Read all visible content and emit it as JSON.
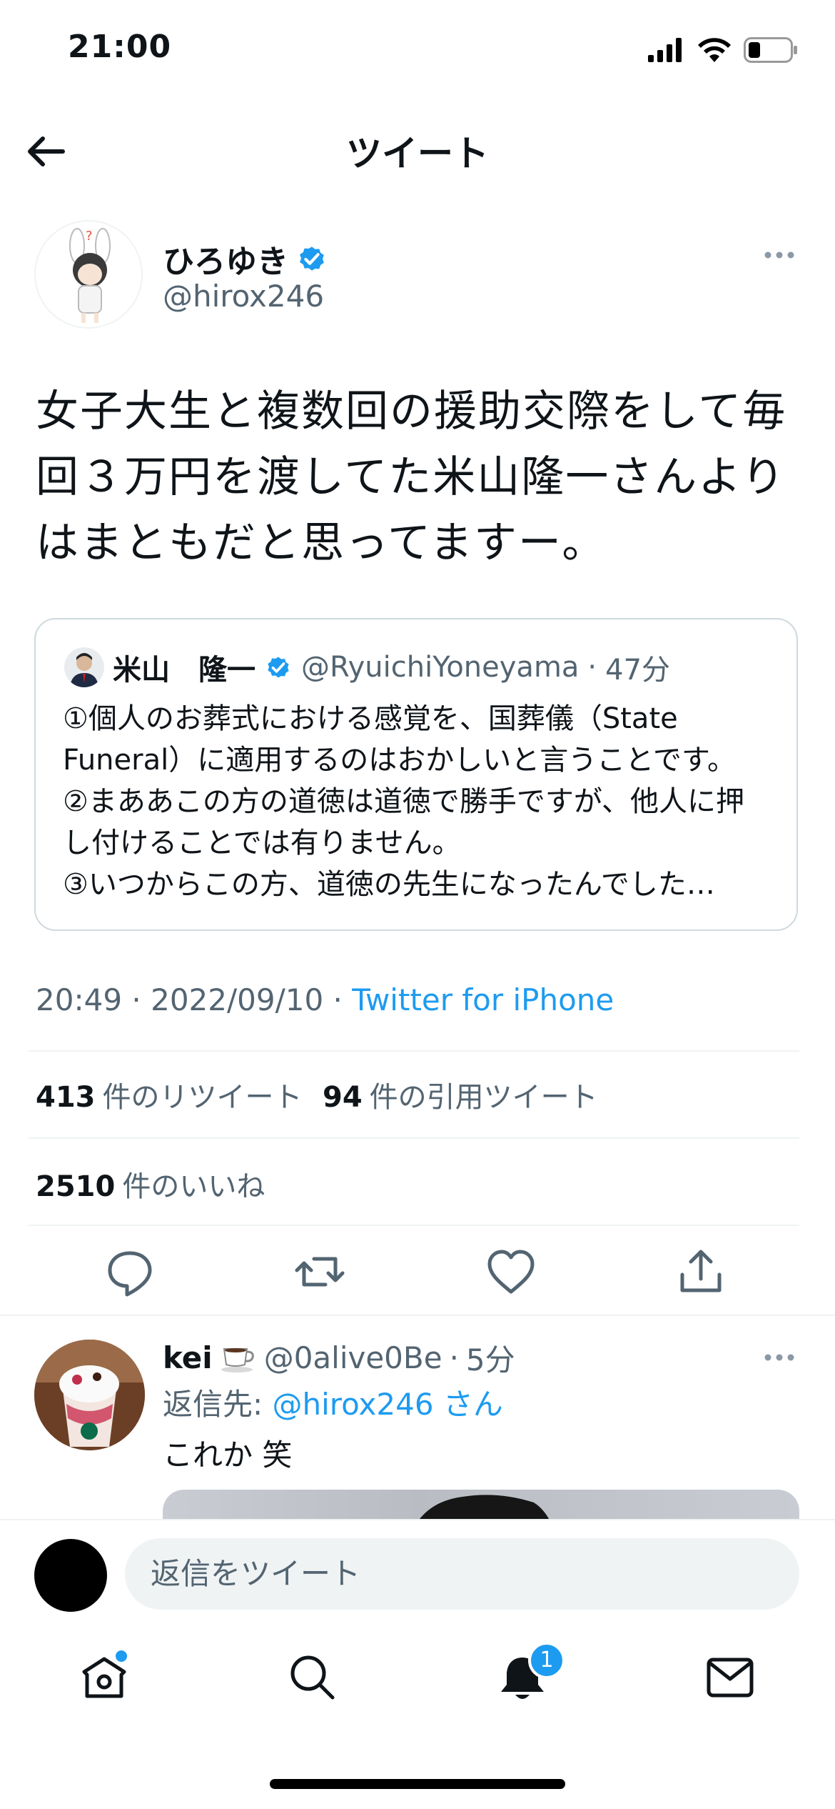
{
  "status": {
    "time": "21:00"
  },
  "header": {
    "title": "ツイート"
  },
  "tweet": {
    "display_name": "ひろゆき",
    "handle": "@hirox246",
    "text_lines": [
      "女子大生と複数回の援助交際をして毎",
      "回３万円を渡してた米山隆一さんより",
      "はまともだと思ってますー。"
    ],
    "quote": {
      "display_name": "米山　隆一",
      "handle": "@RyuichiYoneyama",
      "time": "47分",
      "lines": [
        "①個人のお葬式における感覚を、国葬儀（State",
        "Funeral）に適用するのはおかしいと言うことです。",
        "②まああこの方の道徳は道徳で勝手ですが、他人に押",
        "し付けることでは有りません。",
        "③いつからこの方、道徳の先生になったんでした…"
      ]
    },
    "time": "20:49",
    "date": "2022/09/10",
    "source": "Twitter for iPhone",
    "retweets": "413",
    "retweets_label": "件のリツイート",
    "quotes": "94",
    "quotes_label": "件の引用ツイート",
    "likes": "2510",
    "likes_label": "件のいいね"
  },
  "reply": {
    "display_name": "kei",
    "handle": "@0alive0Be",
    "time": "5分",
    "reply_to_prefix": "返信先:",
    "reply_to_handle": "@hirox246 さん",
    "text": "これか 笑"
  },
  "compose": {
    "placeholder": "返信をツイート"
  },
  "tabs": {
    "notification_count": "1"
  },
  "colors": {
    "accent": "#1d9bf0",
    "text": "#0f1419",
    "secondary": "#536471",
    "border": "#cfd9de"
  }
}
